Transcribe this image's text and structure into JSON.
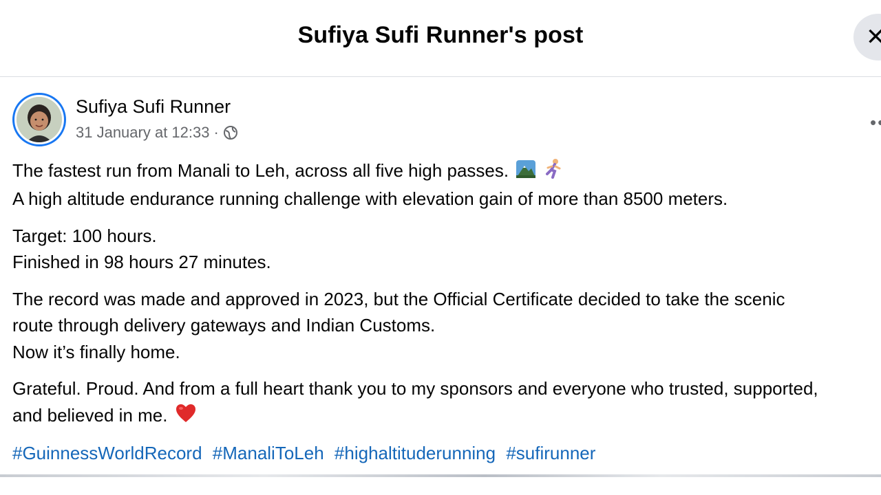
{
  "header": {
    "title": "Sufiya Sufi Runner's post",
    "close_icon": "close-icon"
  },
  "post": {
    "author": "Sufiya Sufi Runner",
    "timestamp": "31 January at 12:33",
    "separator": "·",
    "privacy_icon": "globe-icon",
    "more_icon": "more-options-icon",
    "paragraphs": [
      [
        "The fastest run from Manali to Leh, across all five high passes.",
        "A high altitude endurance running challenge with elevation gain of more than 8500 meters."
      ],
      [
        "Target: 100 hours.",
        "Finished in 98 hours 27 minutes."
      ],
      [
        "The record was made and approved in 2023, but the Official Certificate decided to take the scenic",
        "route through delivery gateways and Indian Customs.",
        "Now it’s finally home."
      ],
      [
        "Grateful. Proud. And from a full heart thank you to my sponsors and everyone who trusted, supported,",
        "and believed in me."
      ]
    ],
    "emojis": {
      "line1": [
        "mountain-emoji",
        "runner-emoji"
      ],
      "grateful": "red-heart-emoji"
    },
    "hashtags": [
      "#GuinnessWorldRecord",
      "#ManaliToLeh",
      "#highaltituderunning",
      "#sufirunner"
    ]
  },
  "colors": {
    "link": "#1567b9",
    "avatar_ring": "#1877f2",
    "meta_text": "#65676b"
  }
}
